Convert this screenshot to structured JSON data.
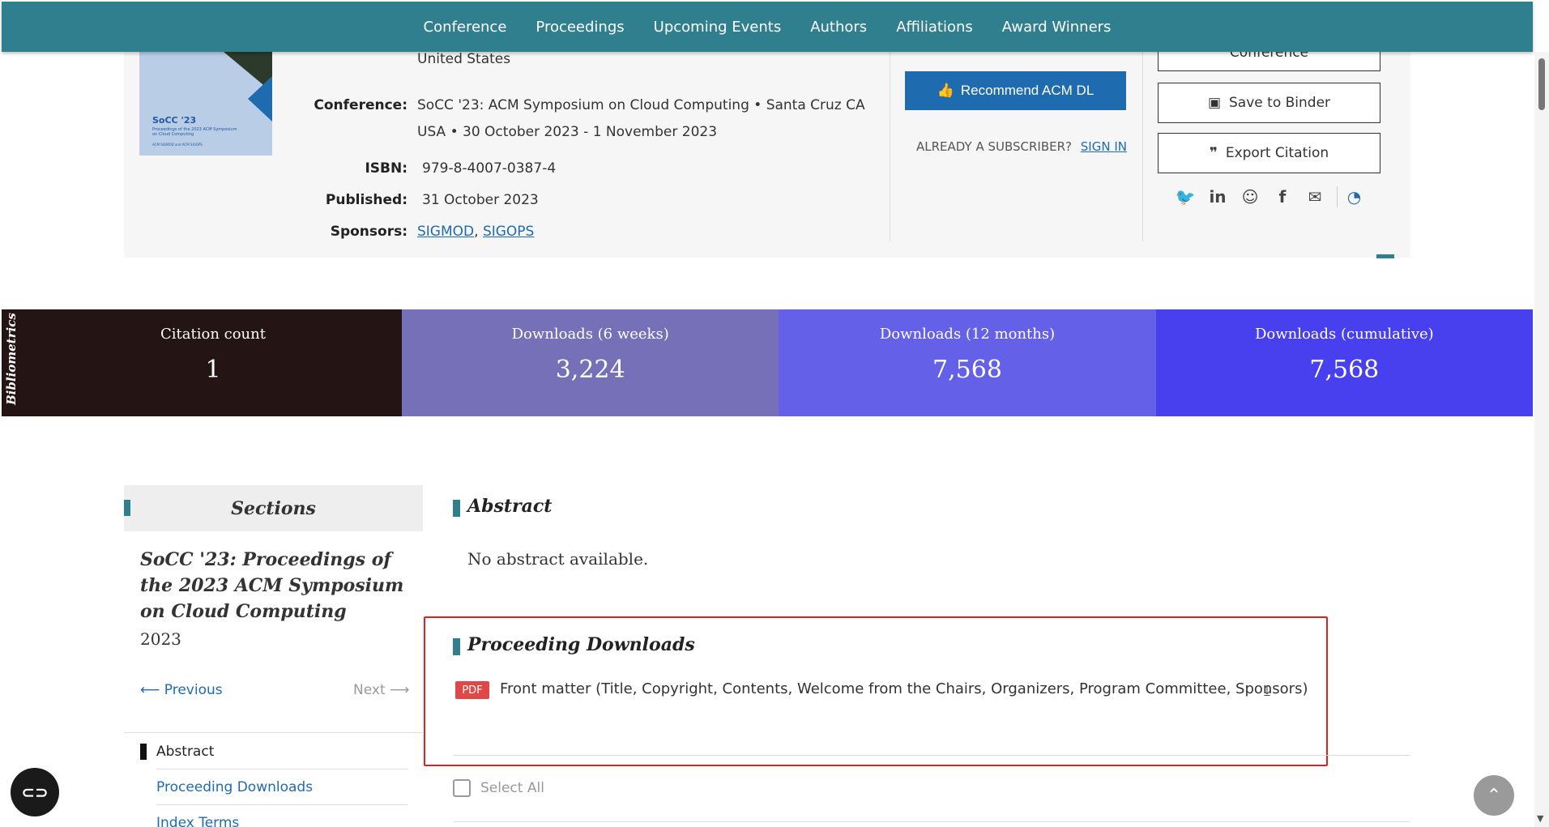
{
  "nav": {
    "items": [
      "Conference",
      "Proceedings",
      "Upcoming Events",
      "Authors",
      "Affiliations",
      "Award Winners"
    ]
  },
  "cover": {
    "title": "SoCC '23",
    "subtitle": "Proceedings of the 2023 ACM Symposium on Cloud Computing",
    "sponsors_small": "ACM SIGMOD and ACM SIGOPS"
  },
  "meta": {
    "location_tail": "United States",
    "conference_label": "Conference:",
    "conference_value_line1": "SoCC '23: ACM Symposium on Cloud Computing •  Santa Cruz CA",
    "conference_value_line2": "USA  • 30 October 2023 - 1 November 2023",
    "isbn_label": "ISBN:",
    "isbn_value": "979-8-4007-0387-4",
    "published_label": "Published:",
    "published_value": "31 October 2023",
    "sponsors_label": "Sponsors:",
    "sponsors": [
      "SIGMOD",
      "SIGOPS"
    ]
  },
  "actions": {
    "recommend": "Recommend ACM DL",
    "subscriber_text": "ALREADY A SUBSCRIBER?",
    "sign_in": "SIGN IN",
    "conference_partial": "Conference",
    "save_binder": "Save to Binder",
    "export_citation": "Export Citation"
  },
  "social": [
    "twitter-icon",
    "linkedin-icon",
    "reddit-icon",
    "facebook-icon",
    "email-icon",
    "rss-icon"
  ],
  "bibliometrics": {
    "label": "Bibliometrics",
    "cells": [
      {
        "label": "Citation count",
        "value": "1"
      },
      {
        "label": "Downloads (6 weeks)",
        "value": "3,224"
      },
      {
        "label": "Downloads (12 months)",
        "value": "7,568"
      },
      {
        "label": "Downloads (cumulative)",
        "value": "7,568"
      }
    ]
  },
  "sidebar": {
    "heading": "Sections",
    "title": "SoCC '23: Proceedings of the 2023 ACM Symposium on Cloud Computing",
    "year": "2023",
    "previous": "Previous",
    "next": "Next",
    "items": [
      "Abstract",
      "Proceeding Downloads",
      "Index Terms"
    ]
  },
  "main": {
    "abstract_heading": "Abstract",
    "abstract_text": "No abstract available.",
    "downloads_heading": "Proceeding Downloads",
    "pdf_badge": "PDF",
    "front_matter": "Front matter (Title, Copyright, Contents, Welcome from the Chairs, Organizers, Program Committee, Sponsors)",
    "select_all": "Select All"
  },
  "colors": {
    "nav": "#2f7f8f",
    "accent": "#1f6bb0",
    "pdf": "#e04848",
    "highlight": "#e02020"
  }
}
